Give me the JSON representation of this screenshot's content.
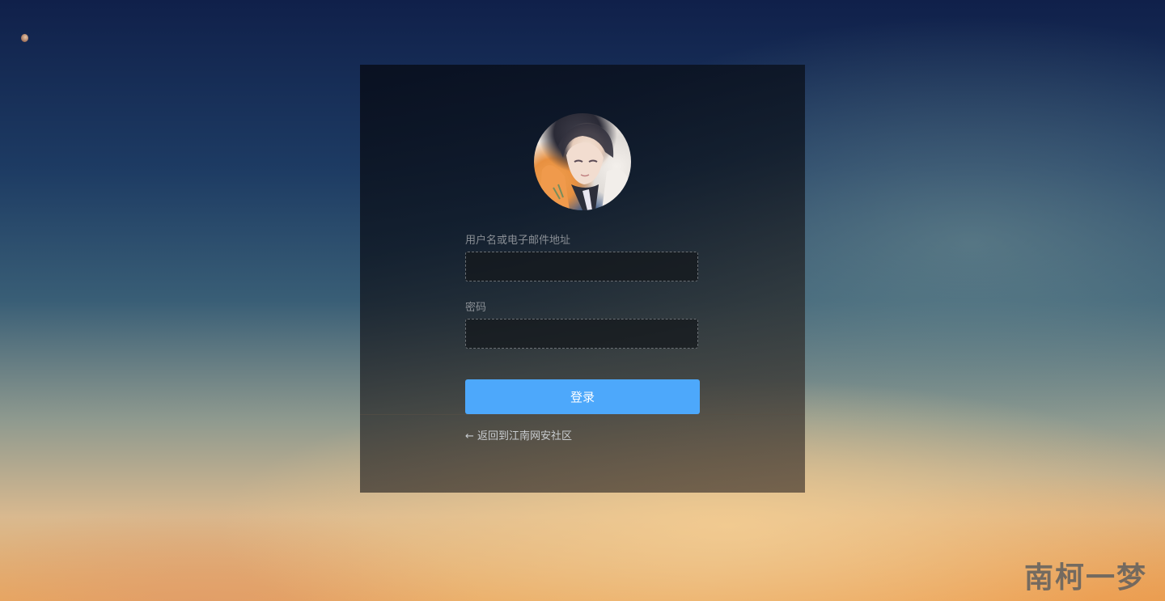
{
  "login": {
    "username_label": "用户名或电子邮件地址",
    "username_value": "",
    "password_label": "密码",
    "password_value": "",
    "submit_label": "登录",
    "back_link": "← 返回到江南网安社区"
  },
  "watermark": "南柯一梦",
  "colors": {
    "accent": "#4da8fb",
    "panel_background": "#0e1622"
  }
}
